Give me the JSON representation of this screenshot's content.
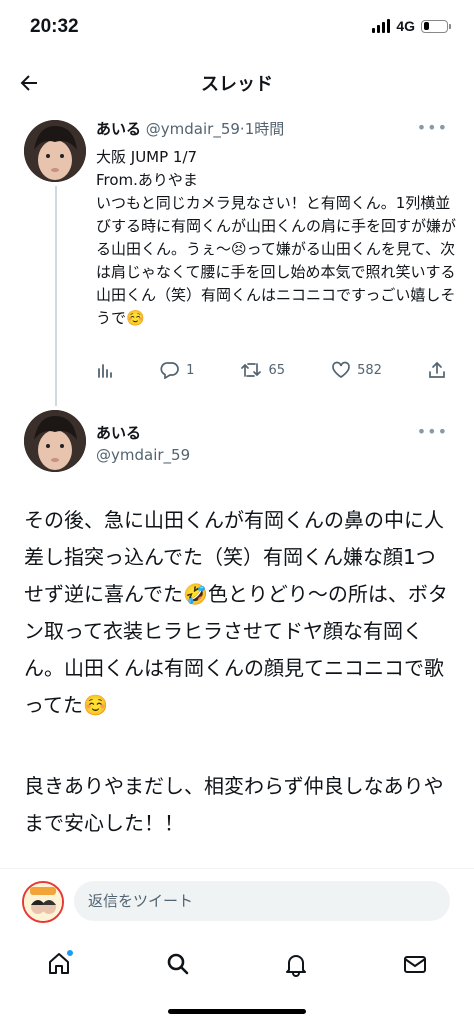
{
  "status_bar": {
    "time": "20:32",
    "network": "4G",
    "battery_level": 0.25
  },
  "header": {
    "title": "スレッド"
  },
  "tweet1": {
    "name": "あいる",
    "handle": "@ymdair_59",
    "time": "·1時間",
    "text": "大阪 JUMP 1/7\nFrom.ありやま\nいつもと同じカメラ見なさい！と有岡くん。1列横並びする時に有岡くんが山田くんの肩に手を回すが嫌がる山田くん。うぇ〜😣って嫌がる山田くんを見て、次は肩じゃなくて腰に手を回し始め本気で照れ笑いする山田くん（笑）有岡くんはニコニコですっごい嬉しそうで☺️",
    "replies": "1",
    "retweets": "65",
    "likes": "582"
  },
  "tweet2": {
    "name": "あいる",
    "handle": "@ymdair_59",
    "text": "その後、急に山田くんが有岡くんの鼻の中に人差し指突っ込んでた（笑）有岡くん嫌な顔1つせず逆に喜んでた🤣色とりどり〜の所は、ボタン取って衣装ヒラヒラさせてドヤ顔な有岡くん。山田くんは有岡くんの顔見てニコニコで歌ってた☺️",
    "text2": "良きありやまだし、相変わらず仲良しなありやまで安心した！！"
  },
  "reply_bar": {
    "placeholder": "返信をツイート"
  },
  "nav": {
    "items": [
      "home-icon",
      "search-icon",
      "notifications-icon",
      "messages-icon"
    ]
  },
  "colors": {
    "accent": "#1d9bf0",
    "muted": "#536471"
  }
}
